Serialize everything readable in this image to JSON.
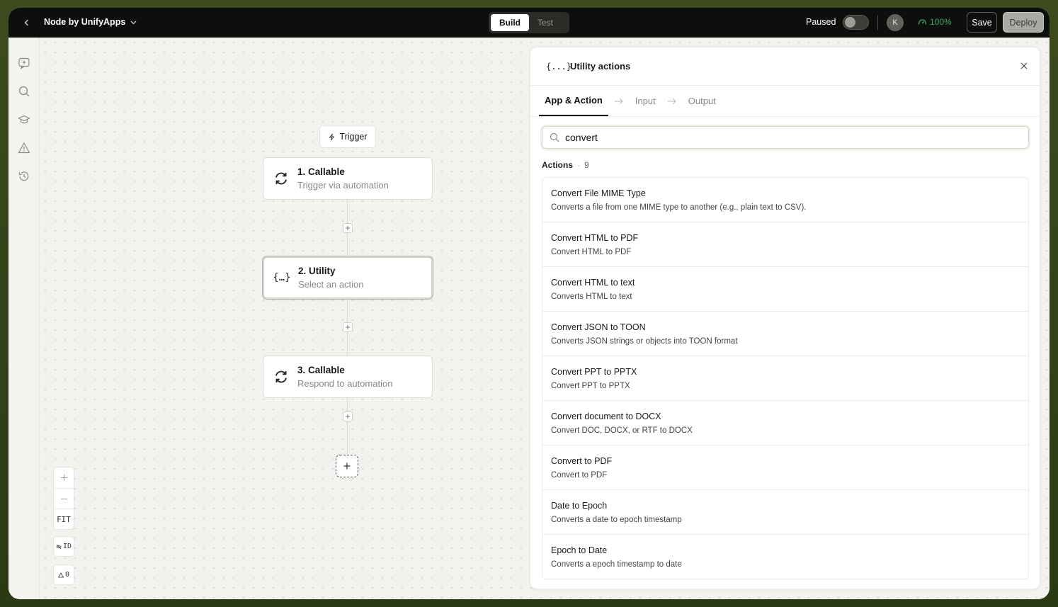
{
  "topbar": {
    "app_title": "Node by UnifyApps",
    "modes": [
      "Build",
      "Test"
    ],
    "active_mode": "Build",
    "paused_label": "Paused",
    "avatar_initial": "K",
    "health_value": "100%",
    "save_label": "Save",
    "deploy_label": "Deploy"
  },
  "canvas": {
    "trigger_label": "Trigger",
    "nodes": [
      {
        "title": "1. Callable",
        "subtitle": "Trigger via automation",
        "icon": "sync-icon"
      },
      {
        "title": "2. Utility",
        "subtitle": "Select an action",
        "icon": "braces-icon"
      },
      {
        "title": "3. Callable",
        "subtitle": "Respond to automation",
        "icon": "sync-icon"
      }
    ],
    "zoom": {
      "fit_label": "FIT",
      "id_label": "ID",
      "warnings_count": "0"
    }
  },
  "panel": {
    "icon_text": "{...}",
    "title": "Utility actions",
    "steps": [
      "App & Action",
      "Input",
      "Output"
    ],
    "active_step": "App & Action",
    "search_value": "convert",
    "actions_label": "Actions",
    "actions_count": "9",
    "actions": [
      {
        "title": "Convert File MIME Type",
        "description": "Converts a file from one MIME type to another (e.g., plain text to CSV)."
      },
      {
        "title": "Convert HTML to PDF",
        "description": "Convert HTML to PDF"
      },
      {
        "title": "Convert HTML to text",
        "description": "Converts HTML to text"
      },
      {
        "title": "Convert JSON to TOON",
        "description": "Converts JSON strings or objects into TOON format"
      },
      {
        "title": "Convert PPT to PPTX",
        "description": "Convert PPT to PPTX"
      },
      {
        "title": "Convert document to DOCX",
        "description": "Convert DOC, DOCX, or RTF to DOCX"
      },
      {
        "title": "Convert to PDF",
        "description": "Convert to PDF"
      },
      {
        "title": "Date to Epoch",
        "description": "Converts a date to epoch timestamp"
      },
      {
        "title": "Epoch to Date",
        "description": "Converts a epoch timestamp to date"
      }
    ]
  },
  "colors": {
    "topbar_bg": "#0d0f0c",
    "health_green": "#3daa66",
    "bezel_olive": "#3d4b1f"
  }
}
